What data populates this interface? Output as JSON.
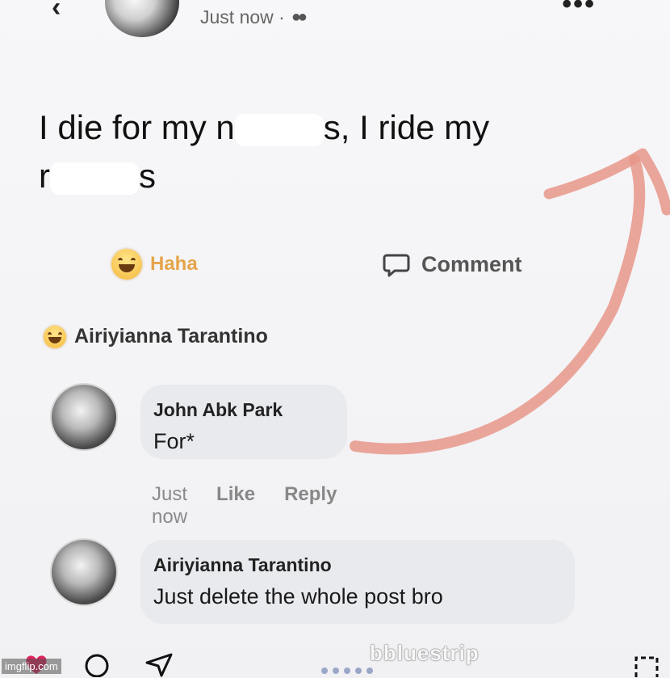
{
  "header": {
    "timestamp": "Just now ·",
    "privacy_icon": "friends-icon"
  },
  "post": {
    "text_line1_start": "I die for my n",
    "text_line1_end": "s, I ride my",
    "text_line2_start": "r",
    "text_line2_end": "s"
  },
  "actions": {
    "haha_label": "Haha",
    "comment_label": "Comment"
  },
  "reacted_by": {
    "name": "Airiyianna Tarantino"
  },
  "comments": [
    {
      "author": "John Abk Park",
      "body": "For*",
      "time": "Just now",
      "like_label": "Like",
      "reply_label": "Reply"
    },
    {
      "author": "Airiyianna Tarantino",
      "body": "Just delete the whole post bro"
    }
  ],
  "watermark": "bbluestrip",
  "imgflip_credit": "imgflip.com",
  "colors": {
    "haha": "#e5a44a",
    "arrow": "#e8968a",
    "bubble": "#e9eaee"
  }
}
